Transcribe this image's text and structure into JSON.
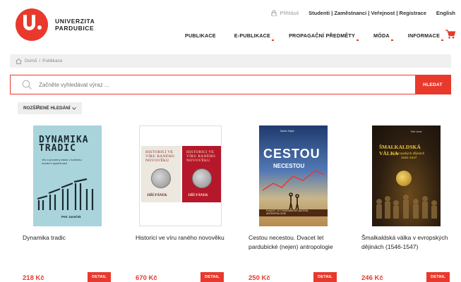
{
  "topbar": {
    "login": "Přihlásit",
    "links": "Studenti | Zaměstnanci | Veřejnost | Registrace",
    "lang": "English"
  },
  "logo": {
    "line1": "UNIVERZITA",
    "line2": "PARDUBICE"
  },
  "nav": [
    {
      "label": "PUBLIKACE"
    },
    {
      "label": "E-PUBLIKACE"
    },
    {
      "label": "PROPAGAČNÍ PŘEDMĚTY"
    },
    {
      "label": "MÓDA"
    },
    {
      "label": "INFORMACE"
    }
  ],
  "breadcrumb": {
    "home": "Domů",
    "separator": "/",
    "current": "Publikace"
  },
  "search": {
    "placeholder": "Začněte vyhledávat výraz ...",
    "button": "HLEDAT"
  },
  "advanced_search": "ROZŠÍŘENÉ HLEDÁNÍ",
  "products": [
    {
      "title": "Dynamika tradic",
      "price": "218 Kč",
      "detail": "DETAIL",
      "cover": {
        "title": "DYNAMIKA TRADIC",
        "subtitle": "Vliv a proměny tradic v kontextu moderní společnosti",
        "author": "Petr Janeček"
      }
    },
    {
      "title": "Historici ve víru raného novověku",
      "price": "670 Kč",
      "detail": "DETAIL",
      "cover": {
        "title": "HISTORICI VE VÍRU RANÉHO NOVOVĚKU",
        "author": "JIŘÍ PÁNEK"
      }
    },
    {
      "title": "Cestou necestou. Dvacet let pardubické (nejen) antropologie",
      "price": "250 Kč",
      "detail": "DETAIL",
      "cover": {
        "top": "Martin Hájek",
        "title": "CESTOU",
        "title2": "NECESTOU",
        "band": "DVACET LET PARDUBICKÉ (NEJEN) ANTROPOLOGIE"
      }
    },
    {
      "title": "Šmalkaldská válka v evropských dějinách (1546-1547)",
      "price": "246 Kč",
      "detail": "DETAIL",
      "cover": {
        "author": "Petr Vorel",
        "title": "ŠMALKALDSKÁ VÁLKA",
        "subtitle": "v evropských dějinách",
        "years": "1546–1547"
      }
    }
  ],
  "colors": {
    "accent": "#e8392c",
    "text": "#222222"
  }
}
